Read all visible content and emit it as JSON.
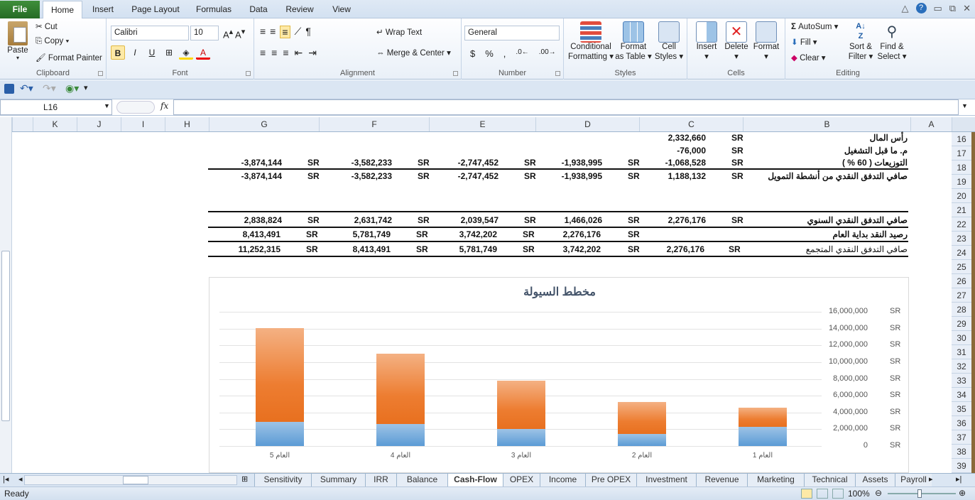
{
  "tabs": {
    "file": "File",
    "home": "Home",
    "insert": "Insert",
    "page_layout": "Page Layout",
    "formulas": "Formulas",
    "data": "Data",
    "review": "Review",
    "view": "View"
  },
  "clipboard": {
    "paste": "Paste",
    "cut": "Cut",
    "copy": "Copy",
    "format_painter": "Format Painter",
    "label": "Clipboard"
  },
  "font": {
    "name": "Calibri",
    "size": "10",
    "label": "Font"
  },
  "alignment": {
    "wrap": "Wrap Text",
    "merge": "Merge & Center",
    "label": "Alignment"
  },
  "number": {
    "format": "General",
    "label": "Number",
    "currency": "$",
    "percent": "%",
    "comma": ","
  },
  "styles": {
    "conditional": "Conditional",
    "formatting": "Formatting",
    "format_as": "Format",
    "as_table": "as Table",
    "cell": "Cell",
    "cell_styles": "Styles",
    "label": "Styles"
  },
  "cells": {
    "insert": "Insert",
    "delete": "Delete",
    "format": "Format",
    "label": "Cells"
  },
  "editing": {
    "autosum": "AutoSum",
    "fill": "Fill",
    "clear": "Clear",
    "sort": "Sort &",
    "filter": "Filter",
    "find": "Find &",
    "select": "Select",
    "label": "Editing"
  },
  "formula_bar": {
    "cell_ref": "L16",
    "fx": "fx",
    "value": ""
  },
  "columns": [
    "K",
    "J",
    "I",
    "H",
    "G",
    "F",
    "E",
    "D",
    "C",
    "B",
    "A"
  ],
  "rows": [
    "16",
    "17",
    "18",
    "19",
    "20",
    "21",
    "22",
    "23",
    "24",
    "25",
    "26",
    "27",
    "28",
    "29",
    "30",
    "31",
    "32",
    "33",
    "34",
    "35",
    "36",
    "37",
    "38",
    "39"
  ],
  "cells_data": {
    "r16": {
      "label": "رأس المال",
      "sr": "SR",
      "c": "2,332,660"
    },
    "r17": {
      "label": "م. ما قبل التشغيل",
      "sr": "SR",
      "c": "-76,000"
    },
    "r18": {
      "label": "التوزيعات ( 60 % )",
      "c_sr": "SR",
      "c": "-1,068,528",
      "d_sr": "SR",
      "d": "-1,938,995",
      "e_sr": "SR",
      "e": "-2,747,452",
      "f_sr": "SR",
      "f": "-3,582,233",
      "g_sr": "SR",
      "g": "-3,874,144"
    },
    "r19": {
      "label": "صافي التدفق النقدي من أنشطة التمويل",
      "c_sr": "SR",
      "c": "1,188,132",
      "d_sr": "SR",
      "d": "-1,938,995",
      "e_sr": "SR",
      "e": "-2,747,452",
      "f_sr": "SR",
      "f": "-3,582,233",
      "g_sr": "SR",
      "g": "-3,874,144"
    },
    "r22": {
      "label": "صافي التدفق النقدي السنوي",
      "c_sr": "SR",
      "c": "2,276,176",
      "d_sr": "SR",
      "d": "1,466,026",
      "e_sr": "SR",
      "e": "2,039,547",
      "f_sr": "SR",
      "f": "2,631,742",
      "g_sr": "SR",
      "g": "2,838,824"
    },
    "r23": {
      "label": "رصيد النقد بداية العام",
      "d_sr": "SR",
      "d": "2,276,176",
      "e_sr": "SR",
      "e": "3,742,202",
      "f_sr": "SR",
      "f": "5,781,749",
      "g_sr": "SR",
      "g": "8,413,491"
    },
    "r24": {
      "label": "صافي التدفق النقدي المتجمع",
      "c_sr": "SR",
      "c": "2,276,176",
      "d_sr": "SR",
      "d": "3,742,202",
      "e_sr": "SR",
      "e": "5,781,749",
      "f_sr": "SR",
      "f": "8,413,491",
      "g_sr": "SR",
      "g": "11,252,315"
    }
  },
  "chart_data": {
    "type": "bar",
    "title": "مخطط السيولة",
    "categories": [
      "العام 1",
      "العام 2",
      "العام 3",
      "العام 4",
      "العام 5"
    ],
    "series": [
      {
        "name": "",
        "values": [
          2276176,
          1466026,
          2039547,
          2631742,
          2838824
        ],
        "color": "#5b9bd5"
      },
      {
        "name": "",
        "values": [
          2276176,
          3742202,
          5781749,
          8413491,
          11252315
        ],
        "color": "#ed7d31"
      }
    ],
    "ylim": [
      0,
      16000000
    ],
    "yticks": [
      "16,000,000",
      "14,000,000",
      "12,000,000",
      "10,000,000",
      "8,000,000",
      "6,000,000",
      "4,000,000",
      "2,000,000",
      "0"
    ],
    "y_unit": "SR",
    "stacked": true,
    "grid": true
  },
  "sheet_tabs": [
    "Sensitivity",
    "Summary",
    "IRR",
    "Balance",
    "Cash-Flow",
    "OPEX",
    "Income",
    "Pre OPEX",
    "Investment",
    "Revenue",
    "Marketing",
    "Technical",
    "Assets",
    "Payroll"
  ],
  "active_sheet": "Cash-Flow",
  "status": {
    "ready": "Ready",
    "zoom": "100%"
  }
}
